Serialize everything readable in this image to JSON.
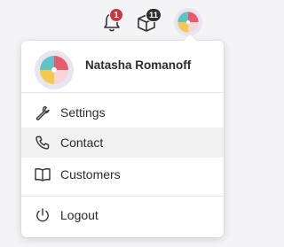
{
  "topbar": {
    "notifications": {
      "icon": "bell-icon",
      "count": "1",
      "badge_color": "#c8373e"
    },
    "packages": {
      "icon": "box-icon",
      "count": "11",
      "badge_color": "#2f2f2f"
    },
    "avatar": {
      "icon": "beach-ball-avatar"
    }
  },
  "menu": {
    "user_name": "Natasha Romanoff",
    "items": [
      {
        "label": "Settings",
        "icon": "wrench-icon"
      },
      {
        "label": "Contact",
        "icon": "phone-icon",
        "active": true
      },
      {
        "label": "Customers",
        "icon": "book-icon"
      }
    ],
    "logout": {
      "label": "Logout",
      "icon": "power-icon"
    }
  }
}
